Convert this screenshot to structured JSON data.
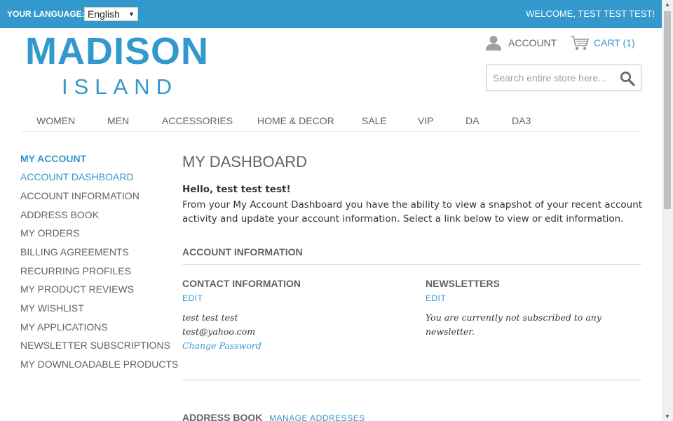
{
  "topbar": {
    "language_label": "YOUR LANGUAGE:",
    "language_value": "English",
    "welcome": "WELCOME, TEST TEST TEST!"
  },
  "logo": {
    "main": "MADISON",
    "sub": "ISLAND"
  },
  "header": {
    "account_label": "ACCOUNT",
    "cart_label": "CART (1)",
    "search_placeholder": "Search entire store here..."
  },
  "nav": {
    "items": [
      {
        "label": "WOMEN"
      },
      {
        "label": "MEN"
      },
      {
        "label": "ACCESSORIES"
      },
      {
        "label": "HOME & DECOR"
      },
      {
        "label": "SALE"
      },
      {
        "label": "VIP"
      },
      {
        "label": "DA"
      },
      {
        "label": "DA3"
      }
    ]
  },
  "sidebar": {
    "title": "MY ACCOUNT",
    "items": [
      {
        "label": "ACCOUNT DASHBOARD",
        "active": true
      },
      {
        "label": "ACCOUNT INFORMATION"
      },
      {
        "label": "ADDRESS BOOK"
      },
      {
        "label": "MY ORDERS"
      },
      {
        "label": "BILLING AGREEMENTS"
      },
      {
        "label": "RECURRING PROFILES"
      },
      {
        "label": "MY PRODUCT REVIEWS"
      },
      {
        "label": "MY WISHLIST"
      },
      {
        "label": "MY APPLICATIONS"
      },
      {
        "label": "NEWSLETTER SUBSCRIPTIONS"
      },
      {
        "label": "MY DOWNLOADABLE PRODUCTS"
      }
    ]
  },
  "main": {
    "title": "MY DASHBOARD",
    "hello": "Hello, test test test!",
    "intro": "From your My Account Dashboard you have the ability to view a snapshot of your recent account activity and update your account information. Select a link below to view or edit information.",
    "account_info": {
      "heading": "ACCOUNT INFORMATION",
      "contact": {
        "heading": "CONTACT INFORMATION",
        "edit": "EDIT",
        "name": "test test test",
        "email": "test@yahoo.com",
        "change_password": "Change Password"
      },
      "newsletters": {
        "heading": "NEWSLETTERS",
        "edit": "EDIT",
        "status_line1": "You are currently not subscribed to any",
        "status_line2": "newsletter."
      }
    },
    "address_book": {
      "heading": "ADDRESS BOOK",
      "manage": "MANAGE ADDRESSES"
    }
  },
  "colors": {
    "accent": "#3399cc",
    "text": "#636363"
  }
}
